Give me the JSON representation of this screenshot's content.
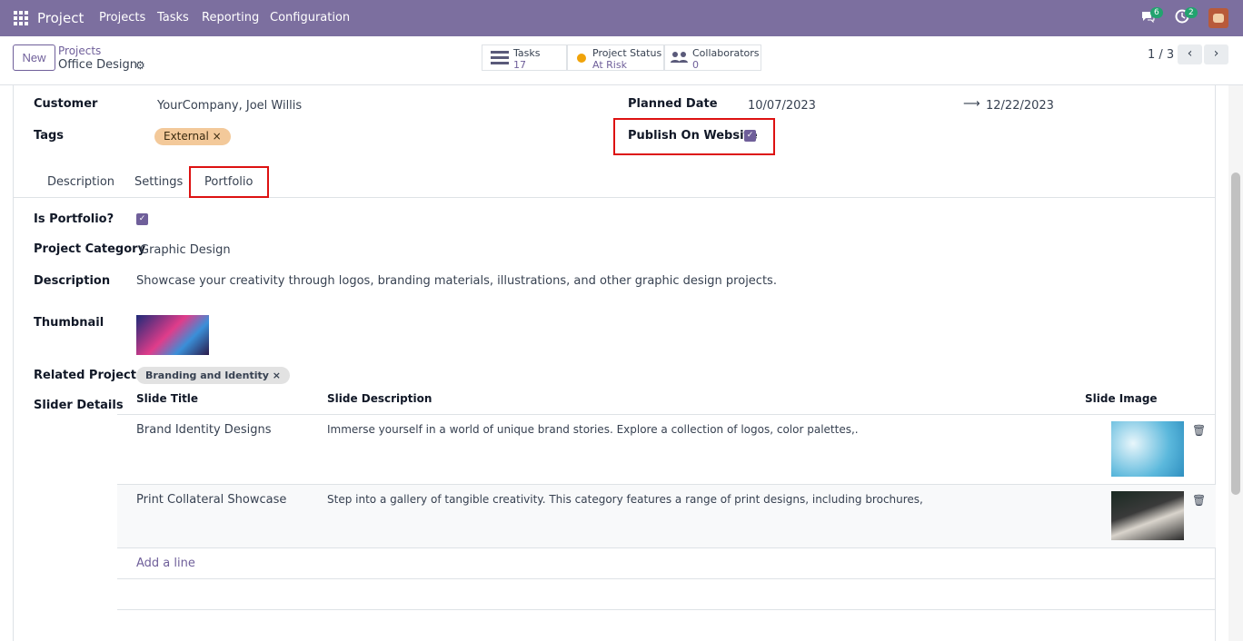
{
  "navbar": {
    "app_name": "Project",
    "menu": [
      "Projects",
      "Tasks",
      "Reporting",
      "Configuration"
    ],
    "messages_count": "6",
    "activity_count": "2"
  },
  "control_panel": {
    "new_label": "New",
    "breadcrumb_parent": "Projects",
    "breadcrumb_current": "Office Design",
    "stats": {
      "tasks_label": "Tasks",
      "tasks_value": "17",
      "status_label": "Project Status",
      "status_value": "At Risk",
      "collab_label": "Collaborators",
      "collab_value": "0"
    },
    "pager": "1 / 3"
  },
  "form": {
    "customer_label": "Customer",
    "customer_value": "YourCompany, Joel Willis",
    "tags_label": "Tags",
    "tag": "External",
    "planned_label": "Planned Date",
    "planned_start": "10/07/2023",
    "planned_end": "12/22/2023",
    "publish_label": "Publish On Website",
    "tabs": [
      "Description",
      "Settings",
      "Portfolio"
    ],
    "portfolio": {
      "is_portfolio_label": "Is Portfolio?",
      "category_label": "Project Category",
      "category_value": "Graphic Design",
      "description_label": "Description",
      "description_value": "Showcase your creativity through logos, branding materials, illustrations, and other graphic design projects.",
      "thumbnail_label": "Thumbnail",
      "related_label": "Related Projects",
      "related_tag": "Branding and Identity",
      "slider_label": "Slider Details",
      "columns": [
        "Slide Title",
        "Slide Description",
        "Slide Image"
      ],
      "rows": [
        {
          "title": "Brand Identity Designs",
          "description": "Immerse yourself in a world of unique brand stories. Explore a collection of logos, color palettes,."
        },
        {
          "title": "Print Collateral Showcase",
          "description": "Step into a gallery of tangible creativity. This category features a range of print designs, including brochures,"
        }
      ],
      "add_line": "Add a line"
    }
  },
  "colors": {
    "navbar": "#7c6f9f",
    "accent": "#6f5f9a",
    "status_dot": "#f0a30a",
    "tag_external": "#f3c99a"
  }
}
